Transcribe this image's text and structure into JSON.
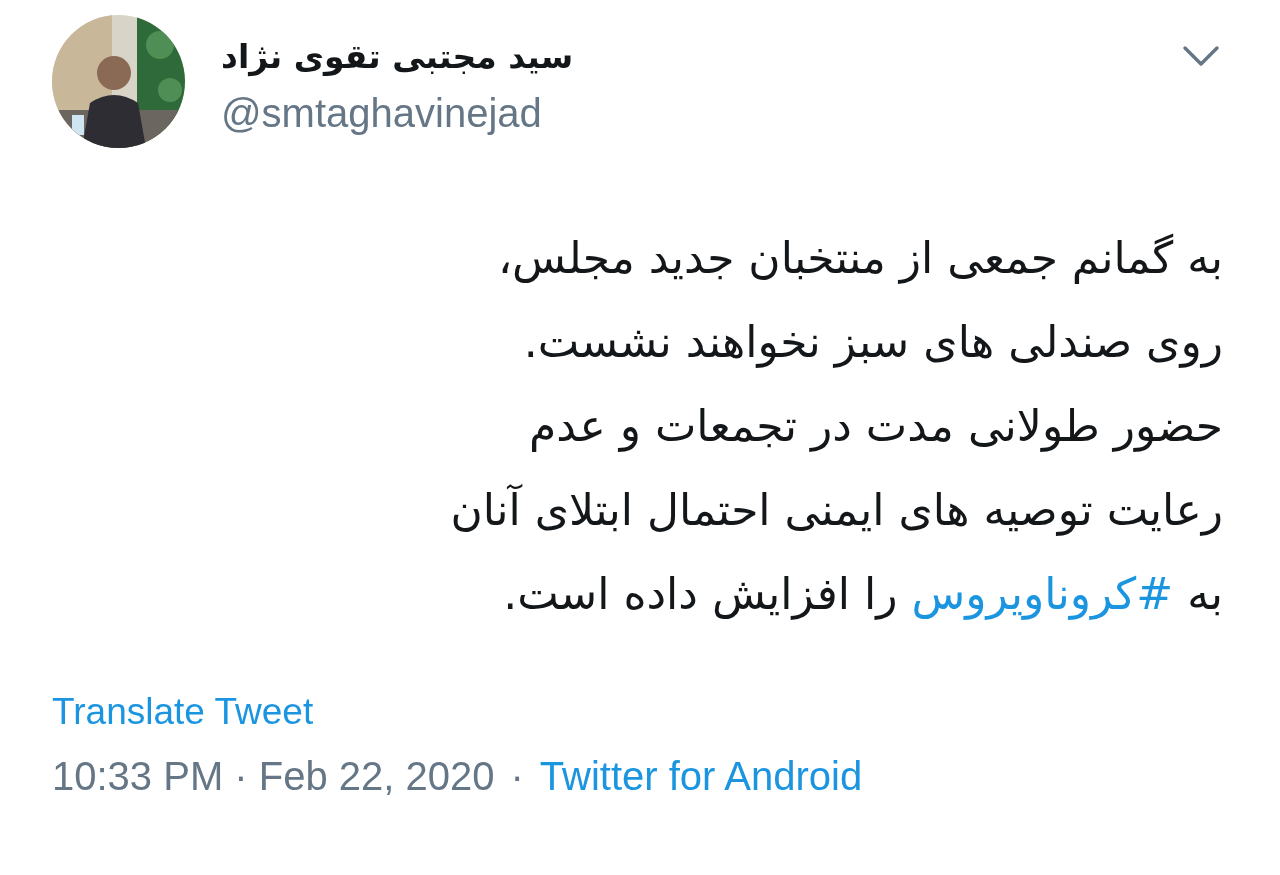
{
  "author": {
    "name": "سید مجتبی تقوی نژاد",
    "handle": "@smtaghavinejad"
  },
  "body": {
    "segments": [
      {
        "kind": "text",
        "text": "به گمانم جمعی از منتخبان جدید مجلس،\nروی صندلی های سبز نخواهند نشست.\nحضور طولانی مدت در تجمعات و عدم\nرعایت توصیه های ایمنی احتمال ابتلای آنان\nبه "
      },
      {
        "kind": "hashtag",
        "text": "#کروناویروس"
      },
      {
        "kind": "text",
        "text": " را افزایش داده است."
      }
    ]
  },
  "translate_link": "Translate Tweet",
  "meta": {
    "timestamp": "10:33 PM · Feb 22, 2020",
    "separator": "·",
    "source": "Twitter for Android"
  }
}
